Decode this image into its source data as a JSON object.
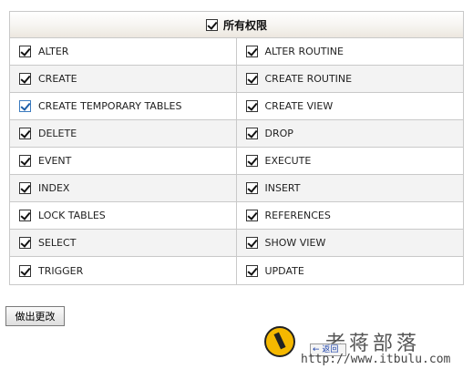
{
  "header": {
    "title": "所有权限",
    "checked": true
  },
  "privileges": [
    [
      {
        "label": "ALTER",
        "checked": true
      },
      {
        "label": "ALTER ROUTINE",
        "checked": true
      }
    ],
    [
      {
        "label": "CREATE",
        "checked": true
      },
      {
        "label": "CREATE ROUTINE",
        "checked": true
      }
    ],
    [
      {
        "label": "CREATE TEMPORARY TABLES",
        "checked": true,
        "focused": true
      },
      {
        "label": "CREATE VIEW",
        "checked": true
      }
    ],
    [
      {
        "label": "DELETE",
        "checked": true
      },
      {
        "label": "DROP",
        "checked": true
      }
    ],
    [
      {
        "label": "EVENT",
        "checked": true
      },
      {
        "label": "EXECUTE",
        "checked": true
      }
    ],
    [
      {
        "label": "INDEX",
        "checked": true
      },
      {
        "label": "INSERT",
        "checked": true
      }
    ],
    [
      {
        "label": "LOCK TABLES",
        "checked": true
      },
      {
        "label": "REFERENCES",
        "checked": true
      }
    ],
    [
      {
        "label": "SELECT",
        "checked": true
      },
      {
        "label": "SHOW VIEW",
        "checked": true
      }
    ],
    [
      {
        "label": "TRIGGER",
        "checked": true
      },
      {
        "label": "UPDATE",
        "checked": true
      }
    ]
  ],
  "actions": {
    "save_label": "做出更改"
  },
  "watermark": {
    "name": "老蒋部落",
    "back_label": "← 返回",
    "url": "http://www.itbulu.com",
    "logo_icon": "pencil-logo-icon"
  }
}
